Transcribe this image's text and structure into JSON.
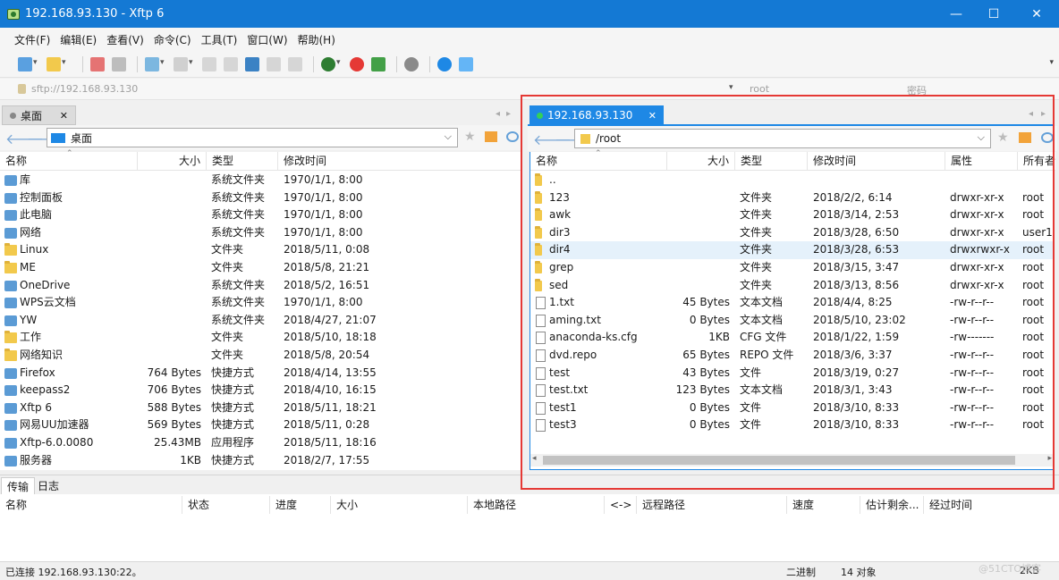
{
  "window": {
    "title": "192.168.93.130    - Xftp 6",
    "minimize": "—",
    "maximize": "☐",
    "close": "✕"
  },
  "menu": [
    "文件(F)",
    "编辑(E)",
    "查看(V)",
    "命令(C)",
    "工具(T)",
    "窗口(W)",
    "帮助(H)"
  ],
  "address": {
    "url": "sftp://192.168.93.130",
    "user_placeholder": "root",
    "password_placeholder": "密码"
  },
  "left": {
    "tab_label": "桌面",
    "path": "桌面",
    "headers": [
      "名称",
      "大小",
      "类型",
      "修改时间"
    ],
    "files": [
      {
        "name": "库",
        "size": "",
        "type": "系统文件夹",
        "mtime": "1970/1/1, 8:00",
        "icon": "library-icon"
      },
      {
        "name": "控制面板",
        "size": "",
        "type": "系统文件夹",
        "mtime": "1970/1/1, 8:00",
        "icon": "control-panel-icon"
      },
      {
        "name": "此电脑",
        "size": "",
        "type": "系统文件夹",
        "mtime": "1970/1/1, 8:00",
        "icon": "computer-icon"
      },
      {
        "name": "网络",
        "size": "",
        "type": "系统文件夹",
        "mtime": "1970/1/1, 8:00",
        "icon": "network-icon"
      },
      {
        "name": "Linux",
        "size": "",
        "type": "文件夹",
        "mtime": "2018/5/11, 0:08",
        "icon": "folder-icon"
      },
      {
        "name": "ME",
        "size": "",
        "type": "文件夹",
        "mtime": "2018/5/8, 21:21",
        "icon": "folder-icon"
      },
      {
        "name": "OneDrive",
        "size": "",
        "type": "系统文件夹",
        "mtime": "2018/5/2, 16:51",
        "icon": "onedrive-icon"
      },
      {
        "name": "WPS云文档",
        "size": "",
        "type": "系统文件夹",
        "mtime": "1970/1/1, 8:00",
        "icon": "cloud-icon"
      },
      {
        "name": "YW",
        "size": "",
        "type": "系统文件夹",
        "mtime": "2018/4/27, 21:07",
        "icon": "user-folder-icon"
      },
      {
        "name": "工作",
        "size": "",
        "type": "文件夹",
        "mtime": "2018/5/10, 18:18",
        "icon": "folder-icon"
      },
      {
        "name": "网络知识",
        "size": "",
        "type": "文件夹",
        "mtime": "2018/5/8, 20:54",
        "icon": "folder-icon"
      },
      {
        "name": "Firefox",
        "size": "764 Bytes",
        "type": "快捷方式",
        "mtime": "2018/4/14, 13:55",
        "icon": "firefox-icon"
      },
      {
        "name": "keepass2",
        "size": "706 Bytes",
        "type": "快捷方式",
        "mtime": "2018/4/10, 16:15",
        "icon": "keepass-icon"
      },
      {
        "name": "Xftp 6",
        "size": "588 Bytes",
        "type": "快捷方式",
        "mtime": "2018/5/11, 18:21",
        "icon": "xftp-icon"
      },
      {
        "name": "网易UU加速器",
        "size": "569 Bytes",
        "type": "快捷方式",
        "mtime": "2018/5/11, 0:28",
        "icon": "uu-icon"
      },
      {
        "name": "Xftp-6.0.0080",
        "size": "25.43MB",
        "type": "应用程序",
        "mtime": "2018/5/11, 18:16",
        "icon": "installer-icon"
      },
      {
        "name": "服务器",
        "size": "1KB",
        "type": "快捷方式",
        "mtime": "2018/2/7, 17:55",
        "icon": "server-icon"
      }
    ]
  },
  "right": {
    "tab_label": "192.168.93.130",
    "path": "/root",
    "headers": [
      "名称",
      "大小",
      "类型",
      "修改时间",
      "属性",
      "所有者"
    ],
    "files": [
      {
        "name": "..",
        "size": "",
        "type": "",
        "mtime": "",
        "attr": "",
        "owner": "",
        "kind": "folder"
      },
      {
        "name": "123",
        "size": "",
        "type": "文件夹",
        "mtime": "2018/2/2, 6:14",
        "attr": "drwxr-xr-x",
        "owner": "root",
        "kind": "folder"
      },
      {
        "name": "awk",
        "size": "",
        "type": "文件夹",
        "mtime": "2018/3/14, 2:53",
        "attr": "drwxr-xr-x",
        "owner": "root",
        "kind": "folder"
      },
      {
        "name": "dir3",
        "size": "",
        "type": "文件夹",
        "mtime": "2018/3/28, 6:50",
        "attr": "drwxr-xr-x",
        "owner": "user1",
        "kind": "folder"
      },
      {
        "name": "dir4",
        "size": "",
        "type": "文件夹",
        "mtime": "2018/3/28, 6:53",
        "attr": "drwxrwxr-x",
        "owner": "root",
        "kind": "folder",
        "selected": true
      },
      {
        "name": "grep",
        "size": "",
        "type": "文件夹",
        "mtime": "2018/3/15, 3:47",
        "attr": "drwxr-xr-x",
        "owner": "root",
        "kind": "folder"
      },
      {
        "name": "sed",
        "size": "",
        "type": "文件夹",
        "mtime": "2018/3/13, 8:56",
        "attr": "drwxr-xr-x",
        "owner": "root",
        "kind": "folder"
      },
      {
        "name": "1.txt",
        "size": "45 Bytes",
        "type": "文本文档",
        "mtime": "2018/4/4, 8:25",
        "attr": "-rw-r--r--",
        "owner": "root",
        "kind": "file"
      },
      {
        "name": "aming.txt",
        "size": "0 Bytes",
        "type": "文本文档",
        "mtime": "2018/5/10, 23:02",
        "attr": "-rw-r--r--",
        "owner": "root",
        "kind": "file"
      },
      {
        "name": "anaconda-ks.cfg",
        "size": "1KB",
        "type": "CFG 文件",
        "mtime": "2018/1/22, 1:59",
        "attr": "-rw-------",
        "owner": "root",
        "kind": "file"
      },
      {
        "name": "dvd.repo",
        "size": "65 Bytes",
        "type": "REPO 文件",
        "mtime": "2018/3/6, 3:37",
        "attr": "-rw-r--r--",
        "owner": "root",
        "kind": "file"
      },
      {
        "name": "test",
        "size": "43 Bytes",
        "type": "文件",
        "mtime": "2018/3/19, 0:27",
        "attr": "-rw-r--r--",
        "owner": "root",
        "kind": "file"
      },
      {
        "name": "test.txt",
        "size": "123 Bytes",
        "type": "文本文档",
        "mtime": "2018/3/1, 3:43",
        "attr": "-rw-r--r--",
        "owner": "root",
        "kind": "file"
      },
      {
        "name": "test1",
        "size": "0 Bytes",
        "type": "文件",
        "mtime": "2018/3/10, 8:33",
        "attr": "-rw-r--r--",
        "owner": "root",
        "kind": "file"
      },
      {
        "name": "test3",
        "size": "0 Bytes",
        "type": "文件",
        "mtime": "2018/3/10, 8:33",
        "attr": "-rw-r--r--",
        "owner": "root",
        "kind": "file"
      }
    ]
  },
  "bottom": {
    "tabs": [
      "传输",
      "日志"
    ],
    "headers": [
      "名称",
      "状态",
      "进度",
      "大小",
      "本地路径",
      "<->",
      "远程路径",
      "速度",
      "估计剩余...",
      "经过时间"
    ]
  },
  "status": {
    "connection": "已连接 192.168.93.130:22。",
    "mode": "二进制",
    "objects": "14 对象",
    "size": "2KB"
  },
  "watermark": "@51CTO博客",
  "colors": {
    "titlebar": "#1479d4",
    "highlight_box": "#e53935",
    "active_tab": "#1e88e5",
    "selection": "#e5f1fb"
  }
}
